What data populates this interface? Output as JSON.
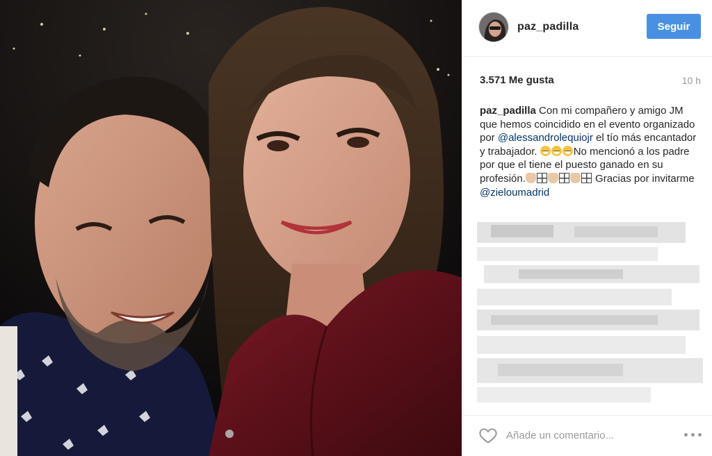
{
  "post": {
    "image_alt": "Selfie of a smiling man and woman at a night event",
    "username": "paz_padilla",
    "follow_label": "Seguir",
    "likes": "3.571 Me gusta",
    "time": "10 h",
    "caption": {
      "username": "paz_padilla",
      "part1": " Con mi compañero y amigo JM que hemos coincidido en el evento organizado por ",
      "mention1": "@alessandrolequiojr",
      "part2": " el tío más encantador y trabajador. ",
      "part3": "No mencionó a los padre por que el tiene el puesto ganado en su profesión.",
      "part4": " Gracias por invitarme ",
      "mention2": "@zieloumadrid"
    },
    "comments_blurred": true
  },
  "comment_bar": {
    "placeholder": "Añade un comentario...",
    "heart_icon": "heart-outline-icon",
    "more_icon": "more-options-icon"
  },
  "colors": {
    "follow_button": "#4a90e2",
    "mention": "#003569",
    "muted": "#999999"
  }
}
